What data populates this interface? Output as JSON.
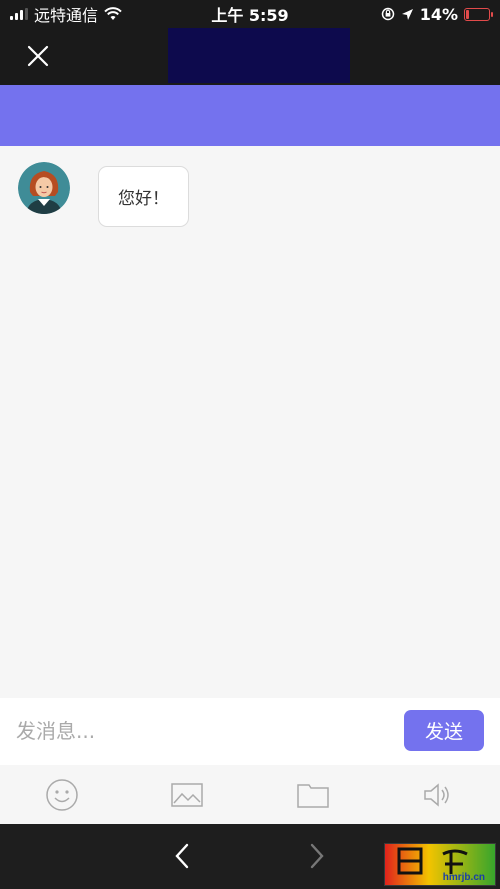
{
  "status_bar": {
    "carrier": "远特通信",
    "time": "上午 5:59",
    "battery_percent": "14%",
    "battery_level": 0.14
  },
  "chat": {
    "messages": [
      {
        "text": "您好！"
      }
    ]
  },
  "composer": {
    "placeholder": "发消息...",
    "send_label": "发送"
  },
  "toolbar": {
    "icons": [
      "emoji-icon",
      "image-icon",
      "folder-icon",
      "speaker-icon"
    ]
  },
  "watermark": {
    "text": "hmrjb.cn"
  },
  "colors": {
    "accent": "#7472ee",
    "title_block": "#0d0a4d",
    "chrome_dark": "#1a1a1a",
    "battery_low": "#e24b4b"
  }
}
